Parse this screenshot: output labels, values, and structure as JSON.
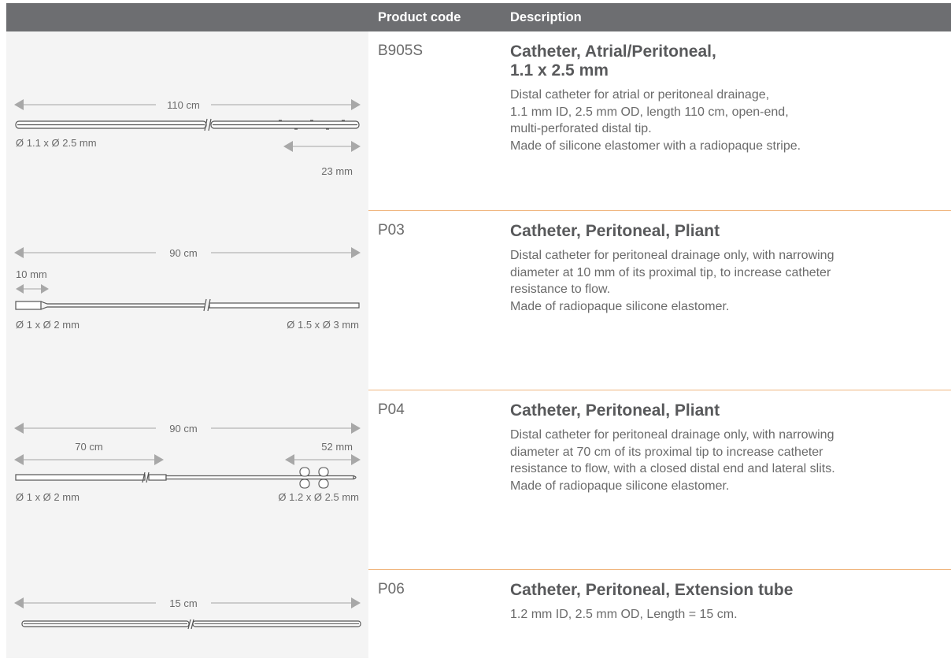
{
  "header": {
    "product_code": "Product code",
    "description": "Description"
  },
  "rows": [
    {
      "code": "B905S",
      "title": "Catheter, Atrial/Peritoneal,\n1.1 x 2.5 mm",
      "body": "Distal catheter for atrial or peritoneal drainage,\n1.1 mm ID, 2.5 mm OD, length 110 cm, open-end,\nmulti-perforated distal tip.\nMade of silicone elastomer with a radiopaque stripe.",
      "diagram": {
        "length": "110 cm",
        "diameter": "Ø 1.1 x Ø 2.5 mm",
        "tip": "23 mm"
      }
    },
    {
      "code": "P03",
      "title": "Catheter, Peritoneal, Pliant",
      "body": "Distal catheter for peritoneal drainage only, with narrowing\ndiameter at 10 mm of its proximal tip, to increase catheter\nresistance to flow.\nMade of radiopaque silicone elastomer.",
      "diagram": {
        "length": "90 cm",
        "narrow": "10 mm",
        "diameter_left": "Ø 1 x Ø 2 mm",
        "diameter_right": "Ø 1.5 x Ø 3 mm"
      }
    },
    {
      "code": "P04",
      "title": "Catheter, Peritoneal, Pliant",
      "body": "Distal catheter for peritoneal drainage only, with narrowing\ndiameter at 70 cm of its proximal tip to increase catheter\nresistance to flow, with a closed distal end and lateral slits.\nMade of radiopaque silicone elastomer.",
      "diagram": {
        "length": "90 cm",
        "section": "70 cm",
        "tip": "52 mm",
        "diameter_left": "Ø 1 x Ø 2 mm",
        "diameter_right": "Ø 1.2 x Ø 2.5 mm"
      }
    },
    {
      "code": "P06",
      "title": "Catheter, Peritoneal, Extension tube",
      "body": "1.2 mm ID, 2.5 mm OD, Length = 15 cm.",
      "diagram": {
        "length": "15 cm"
      }
    }
  ],
  "colors": {
    "header_bg": "#6d6e71",
    "separator": "#f0b67f",
    "image_bg": "#f4f4f4"
  }
}
